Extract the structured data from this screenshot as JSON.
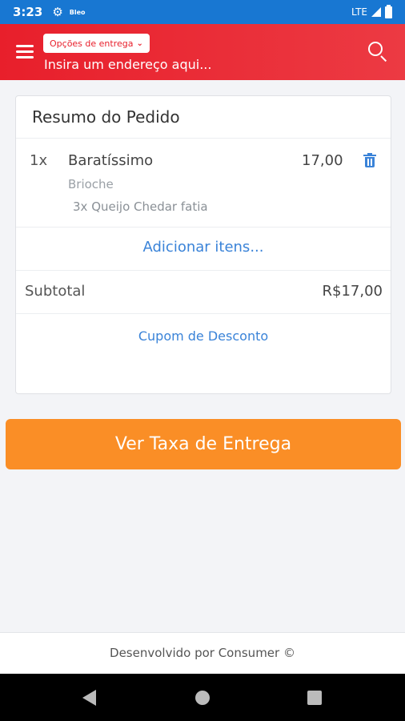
{
  "status_bar": {
    "time": "3:23",
    "settings_icon": "gear-icon",
    "small_label": "Bleo",
    "network": "LTE",
    "signal_icon": "signal-icon",
    "battery_icon": "battery-icon",
    "background": "#1877d2"
  },
  "header": {
    "menu_icon": "hamburger-menu-icon",
    "delivery_options_label": "Opções de entrega",
    "address_placeholder": "Insira um endereço aqui...",
    "search_icon": "search-icon",
    "background": "#e81f2b"
  },
  "order_summary": {
    "title": "Resumo do Pedido",
    "items": [
      {
        "qty": "1x",
        "name": "Baratíssimo",
        "price": "17,00",
        "variant": "Brioche",
        "addon": "3x Queijo Chedar fatia",
        "delete_icon": "trash-icon"
      }
    ],
    "add_items_label": "Adicionar itens...",
    "subtotal_label": "Subtotal",
    "subtotal_value": "R$17,00",
    "coupon_label": "Cupom de Desconto"
  },
  "cta": {
    "label": "Ver Taxa de Entrega",
    "color": "#fa8e26"
  },
  "footer": {
    "text": "Desenvolvido por Consumer ©"
  },
  "nav_bar": {
    "back_icon": "back-triangle-icon",
    "home_icon": "home-circle-icon",
    "recents_icon": "recents-square-icon"
  },
  "colors": {
    "link": "#3a83d8",
    "page_bg": "#f3f4f7"
  }
}
